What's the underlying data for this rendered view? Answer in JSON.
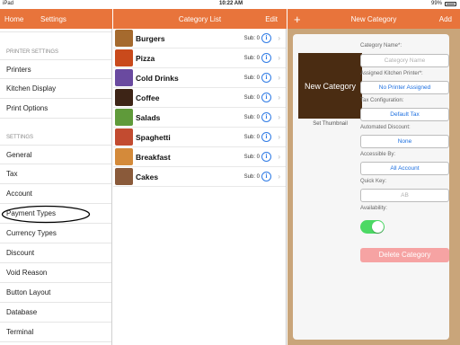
{
  "status": {
    "carrier": "iPad",
    "time": "10:22 AM",
    "battery": "99%"
  },
  "left_header": {
    "back": "Home",
    "title": "Settings"
  },
  "mid_header": {
    "title": "Category List",
    "edit": "Edit"
  },
  "right_header": {
    "add_icon": "+",
    "title": "New Category",
    "add": "Add"
  },
  "settings": {
    "printer_section": "PRINTER SETTINGS",
    "printer_items": [
      "Printers",
      "Kitchen Display",
      "Print Options"
    ],
    "settings_section": "SETTINGS",
    "settings_items": [
      "General",
      "Tax",
      "Account",
      "Payment Types",
      "Currency Types",
      "Discount",
      "Void Reason",
      "Button Layout",
      "Database",
      "Terminal"
    ]
  },
  "categories": [
    {
      "name": "Burgers",
      "sub": "Sub: 0",
      "color": "#a56a2e"
    },
    {
      "name": "Pizza",
      "sub": "Sub: 0",
      "color": "#c94a1c"
    },
    {
      "name": "Cold Drinks",
      "sub": "Sub: 0",
      "color": "#6a4aa0"
    },
    {
      "name": "Coffee",
      "sub": "Sub: 0",
      "color": "#3d2416"
    },
    {
      "name": "Salads",
      "sub": "Sub: 0",
      "color": "#5f9a3a"
    },
    {
      "name": "Spaghetti",
      "sub": "Sub: 0",
      "color": "#c24b30"
    },
    {
      "name": "Breakfast",
      "sub": "Sub: 0",
      "color": "#d48a3a"
    },
    {
      "name": "Cakes",
      "sub": "Sub: 0",
      "color": "#8a5a3a"
    }
  ],
  "form": {
    "preview": "New Category",
    "set_thumbnail": "Set Thumbnail",
    "category_name_label": "Category Name*:",
    "category_name_placeholder": "Category Name",
    "kitchen_printer_label": "Assigned Kitchen Printer*:",
    "kitchen_printer_value": "No Printer Assigned",
    "tax_label": "Tax Configuration:",
    "tax_value": "Default Tax",
    "discount_label": "Automated Discount:",
    "discount_value": "None",
    "accessible_label": "Accessible By:",
    "accessible_value": "All Account",
    "quick_key_label": "Quick Key:",
    "quick_key_value": "AB",
    "availability_label": "Availability:",
    "availability_on": true,
    "delete_label": "Delete Category"
  },
  "colors": {
    "accent": "#e8743b",
    "link": "#1c6fe0",
    "toggle": "#4cd964",
    "delete": "#f6a3a3",
    "wood": "#c9a57a"
  }
}
